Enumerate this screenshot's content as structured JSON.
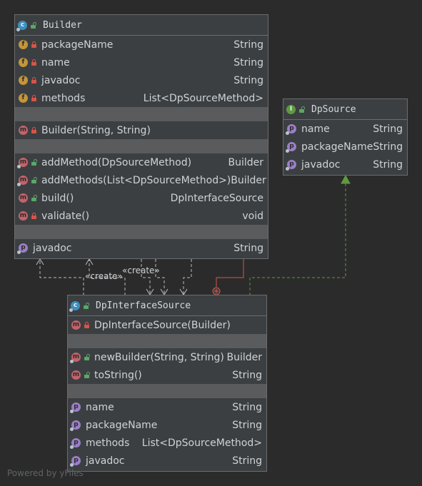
{
  "builder": {
    "title": "Builder",
    "fields": [
      {
        "name": "packageName",
        "type": "String"
      },
      {
        "name": "name",
        "type": "String"
      },
      {
        "name": "javadoc",
        "type": "String"
      },
      {
        "name": "methods",
        "type": "List<DpSourceMethod>"
      }
    ],
    "constructor": {
      "name": "Builder(String, String)",
      "type": ""
    },
    "methods": [
      {
        "name": "addMethod(DpSourceMethod)",
        "type": "Builder"
      },
      {
        "name": "addMethods(List<DpSourceMethod>)",
        "type": "Builder"
      },
      {
        "name": "build()",
        "type": "DpInterfaceSource"
      },
      {
        "name": "validate()",
        "type": "void"
      }
    ],
    "properties": [
      {
        "name": "javadoc",
        "type": "String"
      }
    ]
  },
  "dpsource": {
    "title": "DpSource",
    "properties": [
      {
        "name": "name",
        "type": "String"
      },
      {
        "name": "packageName",
        "type": "String"
      },
      {
        "name": "javadoc",
        "type": "String"
      }
    ]
  },
  "interface_source": {
    "title": "DpInterfaceSource",
    "constructor": {
      "name": "DpInterfaceSource(Builder)",
      "type": ""
    },
    "methods": [
      {
        "name": "newBuilder(String, String)",
        "type": "Builder"
      },
      {
        "name": "toString()",
        "type": "String"
      }
    ],
    "properties": [
      {
        "name": "name",
        "type": "String"
      },
      {
        "name": "packageName",
        "type": "String"
      },
      {
        "name": "methods",
        "type": "List<DpSourceMethod>"
      },
      {
        "name": "javadoc",
        "type": "String"
      }
    ]
  },
  "edges": {
    "create_label_1": "«create»",
    "create_label_2": "«create»"
  },
  "watermark": "Powered by yFiles",
  "colors": {
    "background": "#2b2b2b",
    "node_fill": "#3c3f41",
    "separator": "#595b5d",
    "dependency_line": "#b9bcbe",
    "realization_line": "#5f9a3f",
    "nested_line": "#d7544a"
  }
}
